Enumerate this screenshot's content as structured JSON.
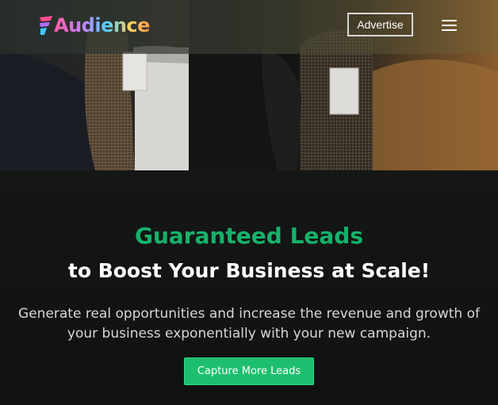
{
  "header": {
    "logo_text": "Audience",
    "advertise_label": "Advertise"
  },
  "hero": {
    "headline": "Guaranteed Leads",
    "subheadline": "to Boost Your Business at Scale!",
    "description": "Generate real opportunities and increase the revenue and growth of your business exponentially with your new campaign.",
    "cta_label": "Capture More Leads"
  },
  "colors": {
    "accent_green": "#16b26a",
    "cta_green": "#1dbf6e",
    "background": "#101211"
  },
  "icons": [
    "logo-mark-icon",
    "hamburger-menu-icon"
  ]
}
